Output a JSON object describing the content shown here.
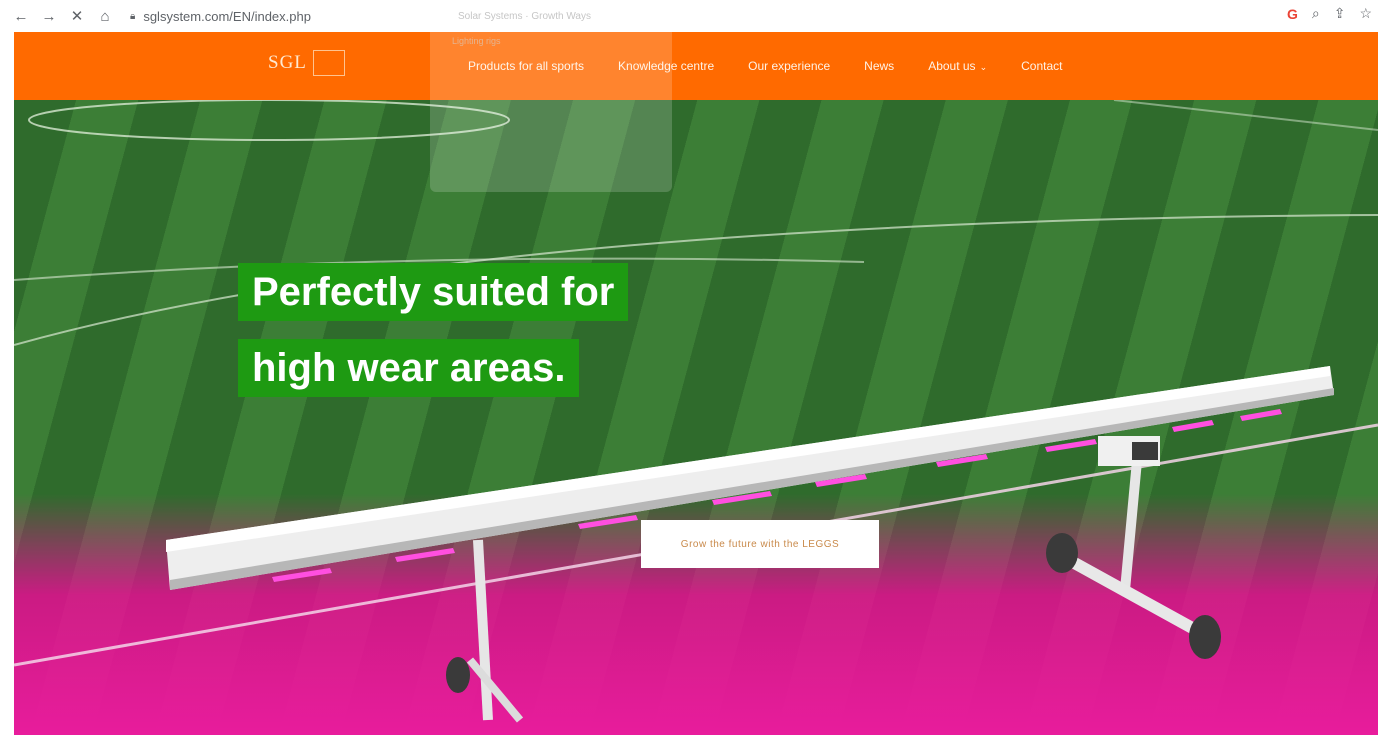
{
  "browser": {
    "url": "sglsystem.com/EN/index.php"
  },
  "nav": {
    "logo_text": "SGL",
    "items": [
      {
        "label": "Products for all sports"
      },
      {
        "label": "Knowledge centre"
      },
      {
        "label": "Our experience"
      },
      {
        "label": "News"
      },
      {
        "label": "About us"
      },
      {
        "label": "Contact"
      }
    ]
  },
  "dropdown": {
    "item_1": "Solar Systems · Growth Ways",
    "item_2": "Lighting rigs"
  },
  "hero": {
    "headline_line1": "Perfectly suited for",
    "headline_line2": "high wear areas.",
    "cta_label": "Grow the future with the LEGGS"
  },
  "colors": {
    "nav_bg": "#ff6a00",
    "headline_bg": "#1e9a12",
    "cta_text": "#c98a4b"
  }
}
